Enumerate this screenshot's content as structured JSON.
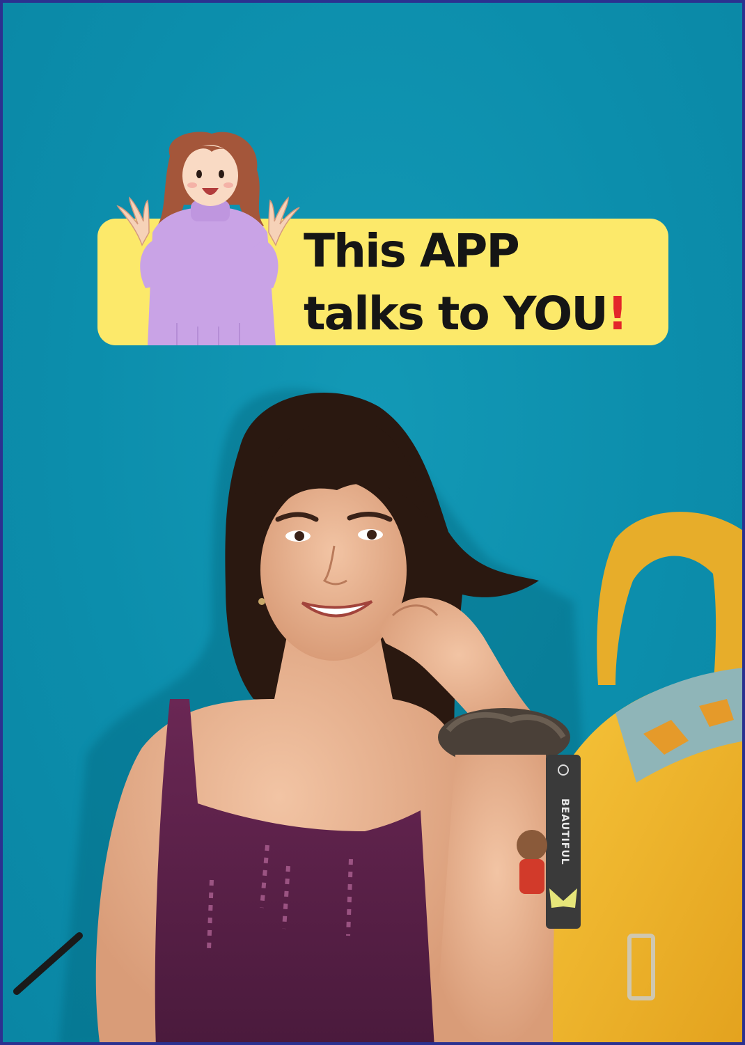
{
  "banner": {
    "line1": "This APP",
    "line2": "talks to YOU",
    "exclamation": "!"
  },
  "bag_strap_text": "BEAUTIFUL",
  "colors": {
    "background": "#0e92b0",
    "border": "#2b3190",
    "banner": "#fce96a",
    "text": "#151515",
    "accent": "#e3262a",
    "cartoon_sweater": "#c9a3e6",
    "dress": "#5a2147",
    "bag": "#f0b62a"
  }
}
